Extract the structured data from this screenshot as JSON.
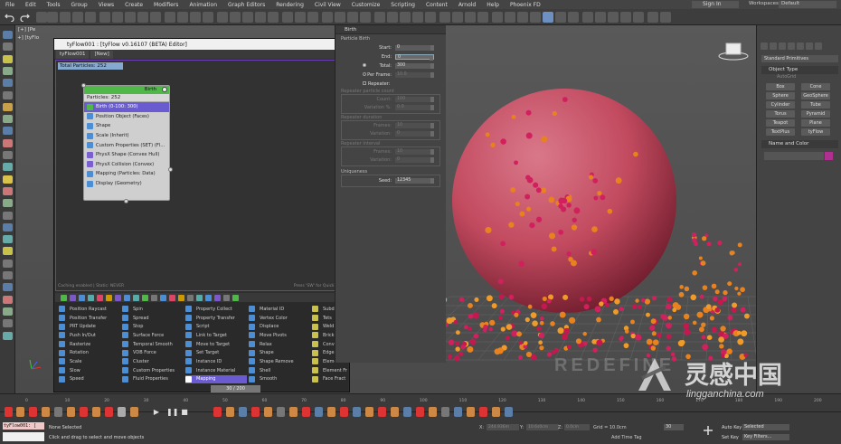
{
  "menubar": {
    "items": [
      "File",
      "Edit",
      "Tools",
      "Group",
      "Views",
      "Create",
      "Modifiers",
      "Animation",
      "Graph Editors",
      "Rendering",
      "Civil View",
      "Customize",
      "Scripting",
      "Content",
      "Arnold",
      "Help",
      "Phoenix FD"
    ],
    "sign_in": "Sign In",
    "workspaces_label": "Workspaces:",
    "workspaces_value": "Default"
  },
  "viewport": {
    "label": "[+] [Pe",
    "label2": "+] [tyFlo"
  },
  "editor": {
    "title": "tyFlow001 : [tyFlow v0.16107 (BETA) Editor]",
    "tabs": [
      "tyFlow001",
      "[New]"
    ],
    "total_particles": "Total Particles: 252",
    "status_left": "Caching enabled | Static: NEVER",
    "status_right": "Press 'SW' for QuickType",
    "node": {
      "header": "Birth",
      "count": "Particles: 252",
      "operators": [
        {
          "label": "Birth (0-100: 300)",
          "color": "#4fb848",
          "selected": true
        },
        {
          "label": "Position Object (Faces)",
          "color": "#4b8ed6",
          "selected": false
        },
        {
          "label": "Shape",
          "color": "#4b8ed6",
          "selected": false
        },
        {
          "label": "Scale (Inherit)",
          "color": "#4b8ed6",
          "selected": false
        },
        {
          "label": "Custom Properties (SET) (Fl...",
          "color": "#4b8ed6",
          "selected": false
        },
        {
          "label": "PhysX Shape (Convex Hull)",
          "color": "#7a5fd0",
          "selected": false
        },
        {
          "label": "PhysX Collision (Convex)",
          "color": "#7a5fd0",
          "selected": false
        },
        {
          "label": "Mapping (Particles: Data)",
          "color": "#4b8ed6",
          "selected": false
        },
        {
          "label": "Display (Geometry)",
          "color": "#4b8ed6",
          "selected": false
        }
      ]
    }
  },
  "palette": {
    "columns": [
      [
        "Position Raycast",
        "Position Transfer",
        "PRT Update",
        "Push In/Out",
        "Rasterize",
        "Rotation",
        "Scale",
        "Slow",
        "Speed"
      ],
      [
        "Spin",
        "Spread",
        "Stop",
        "Surface Force",
        "Temporal Smooth",
        "VDB Force",
        "Cluster",
        "Custom Properties",
        "Fluid Properties"
      ],
      [
        "Property Collect",
        "Property Transfer",
        "Script",
        "Link to Target",
        "Move to Target",
        "Set Target",
        "Instance ID",
        "Instance Material",
        "Mapping"
      ],
      [
        "Material ID",
        "Vertex Color",
        "Displace",
        "Move Pivots",
        "Relax",
        "Shape",
        "Shape Remove",
        "Shell",
        "Smooth"
      ],
      [
        "Subdivide",
        "Tets",
        "Weld",
        "Brick Fract",
        "Convex Hu",
        "Edge Fract",
        "Element At",
        "Element Fr",
        "Face Fract"
      ]
    ],
    "selected": "Mapping"
  },
  "rollout": {
    "title": "Birth",
    "particle_birth": "Particle Birth",
    "start_label": "Start:",
    "start_value": "0",
    "end_label": "End:",
    "end_value": "0",
    "total_label": "Total:",
    "total_value": "300",
    "perframe_label": "Per Frame:",
    "perframe_value": "10.0",
    "repeater_label": "Repeater:",
    "rep_count_group": "Repeater particle count",
    "count_label": "Count:",
    "count_value": "100",
    "variation_pct_label": "Variation %:",
    "variation_pct_value": "0.0",
    "rep_duration_group": "Repeater duration",
    "frames_label": "Frames:",
    "frames_value": "10",
    "variation_label": "Variation:",
    "variation_value": "0",
    "rep_interval_group": "Repeater interval",
    "frames2_value": "10",
    "variation2_value": "0",
    "uniqueness": "Uniqueness",
    "seed_label": "Seed:",
    "seed_value": "12345"
  },
  "cmdpanel": {
    "dropdown": "Standard Primitives",
    "object_type": "Object Type",
    "autogrid": "AutoGrid",
    "buttons": [
      "Box",
      "Cone",
      "Sphere",
      "GeoSphere",
      "Cylinder",
      "Tube",
      "Torus",
      "Pyramid",
      "Teapot",
      "Plane",
      "TextPlus",
      "tyFlow"
    ],
    "name_and_color": "Name and Color",
    "color": "#b0308f"
  },
  "timeline": {
    "slider": "30 / 200",
    "ticks": [
      "0",
      "10",
      "20",
      "30",
      "40",
      "50",
      "60",
      "70",
      "80",
      "90",
      "100",
      "110",
      "120",
      "130",
      "140",
      "150",
      "160",
      "170",
      "180",
      "190",
      "200"
    ]
  },
  "statusbar": {
    "maxscript": "tyFlow001: [",
    "none_selected": "None Selected",
    "prompt": "Click and drag to select and move objects",
    "x_label": "X:",
    "x_value": "244.936m",
    "y_label": "Y:",
    "y_value": "10.6s0cm",
    "z_label": "Z:",
    "z_value": "0.0cm",
    "grid": "Grid = 10.0cm",
    "add_time_tag": "Add Time Tag",
    "auto_key": "Auto Key",
    "set_key": "Set Key",
    "selected": "Selected",
    "key_filters": "Key Filters...",
    "frame_value": "30"
  },
  "watermark": {
    "redefine": "REDEFINE",
    "cn": "灵感中国",
    "url": "lingganchina.com"
  }
}
